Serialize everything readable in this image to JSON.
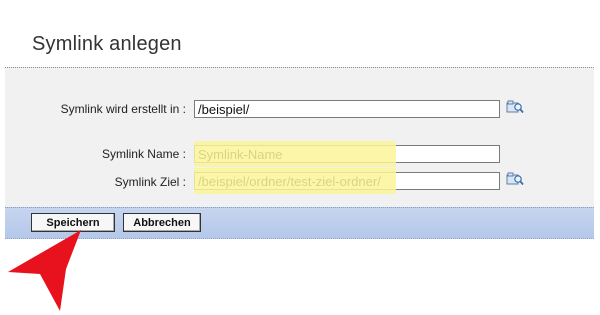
{
  "page": {
    "title": "Symlink anlegen"
  },
  "form": {
    "location_label": "Symlink wird erstellt in :",
    "location_value": "/beispiel/",
    "name_label": "Symlink Name :",
    "name_value": "Symlink-Name",
    "target_label": "Symlink Ziel :",
    "target_value": "/beispiel/ordner/test-ziel-ordner/"
  },
  "buttons": {
    "save": "Speichern",
    "cancel": "Abbrechen"
  },
  "colors": {
    "highlight": "#fbf49a",
    "arrow": "#e8121e",
    "buttonbar": "#bccded"
  },
  "icons": {
    "browse": "folder-browse-icon"
  }
}
